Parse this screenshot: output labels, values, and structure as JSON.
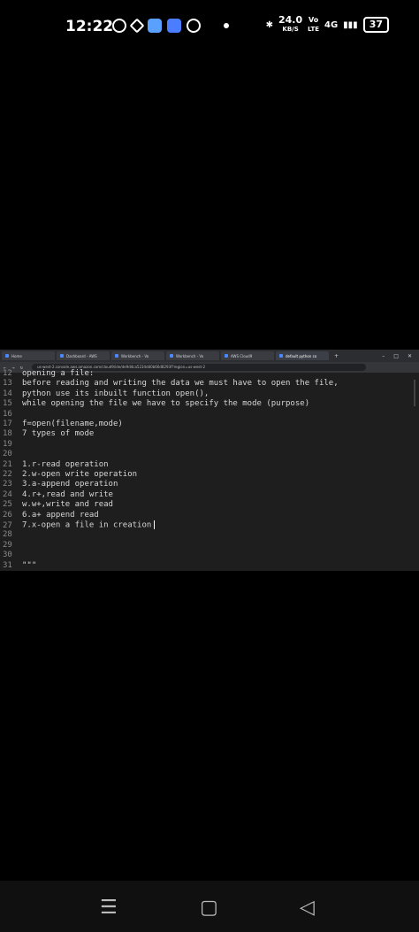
{
  "status": {
    "time": "12:22",
    "speed": "24.0",
    "speed_unit": "KB/S",
    "volte": "Vo",
    "lte": "LTE",
    "network": "4G",
    "battery": "37"
  },
  "browser": {
    "tabs": [
      "Home",
      "Dashboard - AWS",
      "Workbench - Vo",
      "Workbench - Vo",
      "AWS Cloud9",
      "default python co"
    ],
    "url": "us-west-2.console.aws.amazon.com/cloud9/ide/de9d4ca5234dd0b66d8293f?region=us-west-2"
  },
  "editor": {
    "lines": [
      {
        "n": "12",
        "t": "opening a file:"
      },
      {
        "n": "13",
        "t": "before reading and writing the data we must have to open the file,"
      },
      {
        "n": "14",
        "t": "python use its inbuilt function open(),"
      },
      {
        "n": "15",
        "t": "while opening the file we have to specify the mode (purpose)"
      },
      {
        "n": "16",
        "t": ""
      },
      {
        "n": "17",
        "t": "f=open(filename,mode)"
      },
      {
        "n": "18",
        "t": "7 types of mode"
      },
      {
        "n": "19",
        "t": ""
      },
      {
        "n": "20",
        "t": ""
      },
      {
        "n": "21",
        "t": "1.r-read operation"
      },
      {
        "n": "22",
        "t": "2.w-open write operation"
      },
      {
        "n": "23",
        "t": "3.a-append operation"
      },
      {
        "n": "24",
        "t": "4.r+,read and write"
      },
      {
        "n": "25",
        "t": "w.w+,write and read"
      },
      {
        "n": "26",
        "t": "6.a+ append read"
      },
      {
        "n": "27",
        "t": "7.x-open a file in creation"
      },
      {
        "n": "28",
        "t": ""
      },
      {
        "n": "29",
        "t": ""
      },
      {
        "n": "30",
        "t": ""
      },
      {
        "n": "31",
        "t": "\"\"\""
      }
    ]
  }
}
